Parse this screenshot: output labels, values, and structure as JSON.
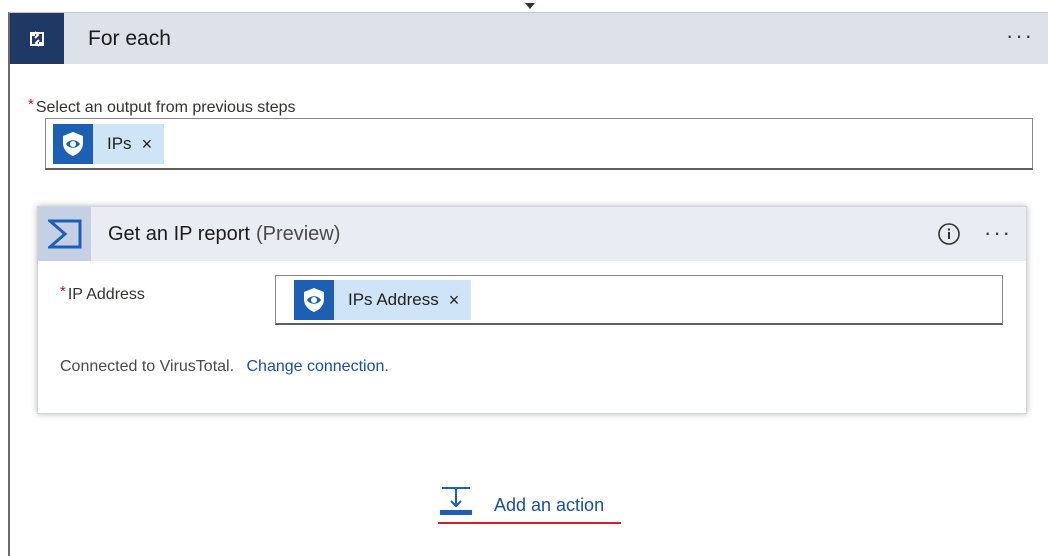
{
  "foreach": {
    "title": "For each",
    "more": "···"
  },
  "select_output": {
    "label": "Select an output from previous steps",
    "token_label": "IPs",
    "remove": "×"
  },
  "action": {
    "title": "Get an IP report",
    "preview": "(Preview)",
    "more": "···",
    "ip_field": {
      "label": "IP Address",
      "token_label": "IPs Address",
      "remove": "×"
    },
    "connection": {
      "text": "Connected to VirusTotal.",
      "link": "Change connection."
    }
  },
  "add_action": {
    "label": "Add an action"
  },
  "colors": {
    "header_bg": "#dde1ea",
    "foreach_icon_bg": "#1f3864",
    "token_bg": "#cfe4f7",
    "token_icon_bg": "#1d5fb3",
    "link": "#1a4fa0",
    "required": "#c50f1f",
    "underline": "#d21f2b"
  },
  "icons": {
    "foreach": "loop-icon",
    "token": "shield-eye-icon",
    "action": "virustotal-sigma-icon",
    "info": "info-icon",
    "add_action": "add-action-icon"
  }
}
